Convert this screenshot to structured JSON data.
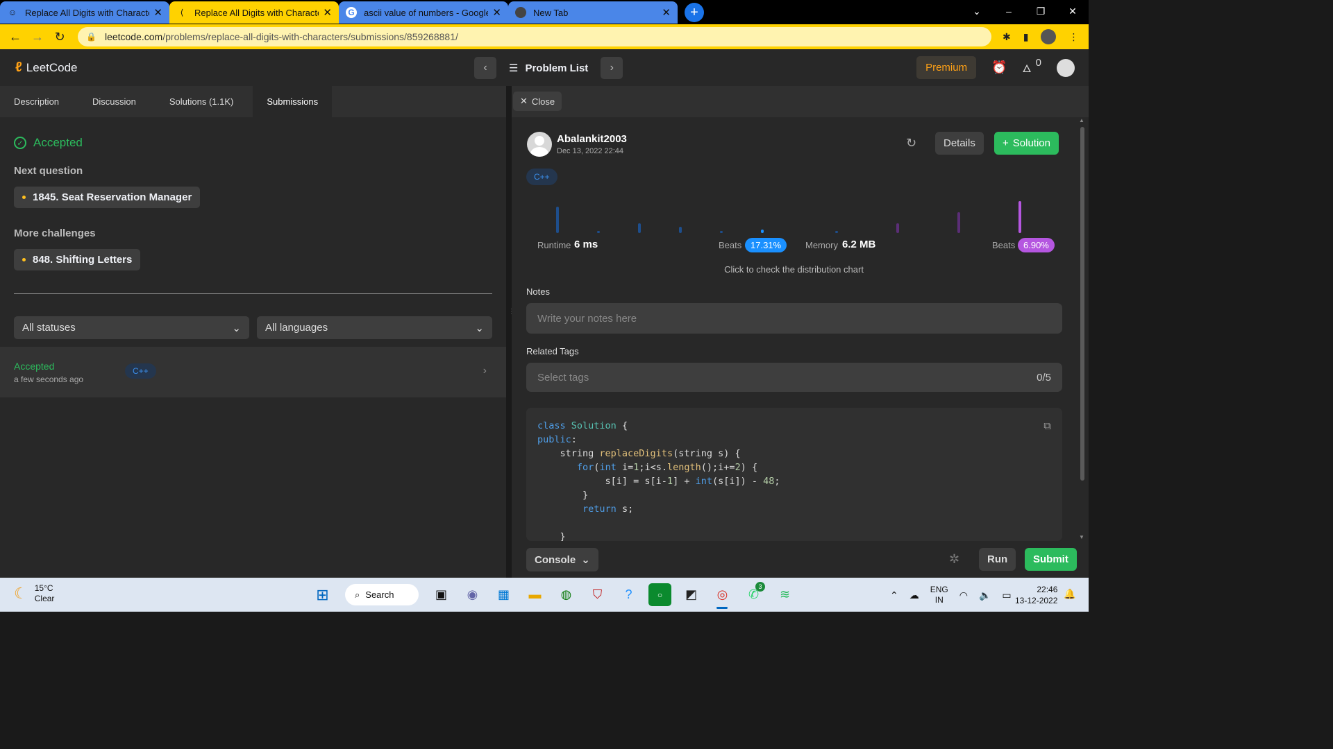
{
  "browser": {
    "tabs": [
      {
        "title": "Replace All Digits with Characters",
        "favicon": "leetcode-smiley-icon",
        "active": false
      },
      {
        "title": "Replace All Digits with Characters",
        "favicon": "leetcode-icon",
        "active": true
      },
      {
        "title": "ascii value of numbers - Google S",
        "favicon": "google-icon",
        "active": false
      },
      {
        "title": "New Tab",
        "favicon": "chrome-icon",
        "active": false
      }
    ],
    "url_host": "leetcode.com",
    "url_path": "/problems/replace-all-digits-with-characters/submissions/859268881/",
    "accent": "#ffd200"
  },
  "header": {
    "logo_text": "LeetCode",
    "problem_list_label": "Problem List",
    "premium_label": "Premium",
    "streak_count": "0"
  },
  "left": {
    "tabs": [
      "Description",
      "Discussion",
      "Solutions (1.1K)",
      "Submissions"
    ],
    "active_tab": "Submissions",
    "status_title": "Accepted",
    "next_question_label": "Next question",
    "next_question": "1845. Seat Reservation Manager",
    "more_challenges_label": "More challenges",
    "more_challenge": "848. Shifting Letters",
    "status_filter": "All statuses",
    "language_filter": "All languages",
    "submissions": [
      {
        "status": "Accepted",
        "time": "a few seconds ago",
        "language": "C++"
      }
    ]
  },
  "right": {
    "close_label": "Close",
    "username": "Abalankit2003",
    "date": "Dec 13, 2022 22:44",
    "details_label": "Details",
    "solution_label": "Solution",
    "language": "C++",
    "runtime_label": "Runtime",
    "runtime_value": "6 ms",
    "runtime_beats_label": "Beats",
    "runtime_beats": "17.31%",
    "memory_label": "Memory",
    "memory_value": "6.2 MB",
    "memory_beats_label": "Beats",
    "memory_beats": "6.90%",
    "distribution_hint": "Click to check the distribution chart",
    "notes_label": "Notes",
    "notes_placeholder": "Write your notes here",
    "tags_label": "Related Tags",
    "tags_placeholder": "Select tags",
    "tags_count": "0/5",
    "console_label": "Console",
    "run_label": "Run",
    "submit_label": "Submit"
  },
  "code_lines": [
    "class Solution {",
    "public:",
    "    string replaceDigits(string s) {",
    "       for(int i=1;i<s.length();i+=2) {",
    "            s[i] = s[i-1] + int(s[i]) - 48;",
    "        }",
    "        return s;",
    "",
    "    }"
  ],
  "taskbar": {
    "temperature": "15°C",
    "weather": "Clear",
    "search_label": "Search",
    "whatsapp_badge": "3",
    "lang_line1": "ENG",
    "lang_line2": "IN",
    "time": "22:46",
    "date": "13-12-2022"
  },
  "colors": {
    "accepted": "#2cbb5d",
    "runtime_beats": "#1a90ff",
    "memory_beats": "#b556e0",
    "brand": "#ffa116"
  }
}
